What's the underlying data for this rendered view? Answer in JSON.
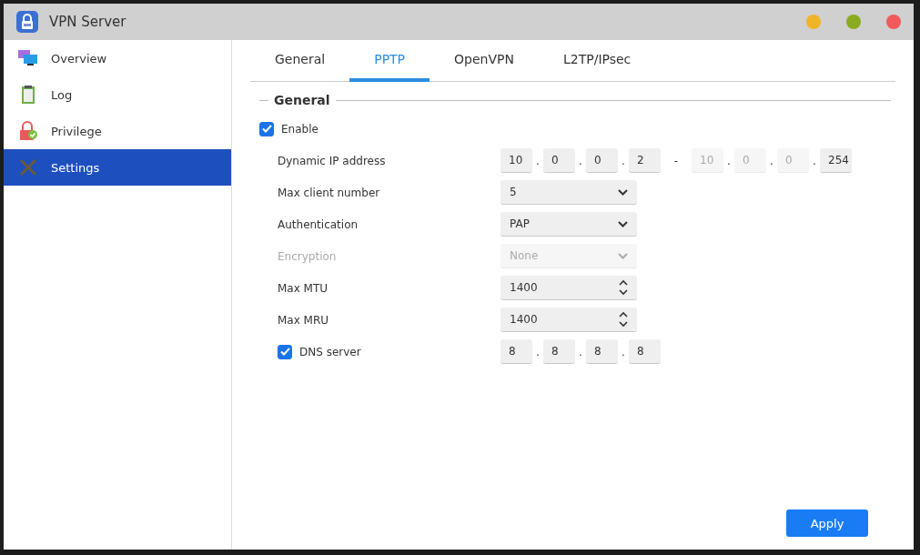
{
  "window": {
    "title": "VPN Server",
    "controls": [
      {
        "color": "#f0b429"
      },
      {
        "color": "#8aab1f"
      },
      {
        "color": "#f05a5a"
      }
    ]
  },
  "sidebar": {
    "items": [
      {
        "label": "Overview",
        "kind": "monitors",
        "selected": false
      },
      {
        "label": "Log",
        "kind": "clipboard",
        "selected": false
      },
      {
        "label": "Privilege",
        "kind": "lock",
        "selected": false
      },
      {
        "label": "Settings",
        "kind": "tools",
        "selected": true
      }
    ]
  },
  "tabs": [
    {
      "label": "General",
      "selected": false
    },
    {
      "label": "PPTP",
      "selected": true
    },
    {
      "label": "OpenVPN",
      "selected": false
    },
    {
      "label": "L2TP/IPsec",
      "selected": false
    }
  ],
  "section": {
    "title": "General"
  },
  "rows": [
    {
      "kind": "checkbox",
      "label": "Enable",
      "checked": true
    },
    {
      "kind": "ip_range",
      "label": "Dynamic IP address",
      "start_dots": [
        ".",
        ".",
        "."
      ],
      "end_dots": [
        ".",
        ".",
        "."
      ],
      "start": [
        {
          "value": "10",
          "disabled": false
        },
        {
          "value": "0",
          "disabled": false
        },
        {
          "value": "0",
          "disabled": false
        },
        {
          "value": "2",
          "disabled": false
        }
      ],
      "separator": "-",
      "end": [
        {
          "value": "10",
          "disabled": true
        },
        {
          "value": "0",
          "disabled": true
        },
        {
          "value": "0",
          "disabled": true
        },
        {
          "value": "254",
          "disabled": false
        }
      ]
    },
    {
      "kind": "select",
      "label": "Max client number",
      "value": "5",
      "disabled": false
    },
    {
      "kind": "select",
      "label": "Authentication",
      "value": "PAP",
      "disabled": false
    },
    {
      "kind": "select",
      "label": "Encryption",
      "value": "None",
      "disabled": true
    },
    {
      "kind": "number",
      "label": "Max MTU",
      "value": "1400",
      "disabled": false
    },
    {
      "kind": "number",
      "label": "Max MRU",
      "value": "1400",
      "disabled": false
    },
    {
      "kind": "ip_check",
      "label": "DNS server",
      "checked": true,
      "dots": [
        ".",
        ".",
        "."
      ],
      "octets": [
        {
          "value": "8",
          "disabled": false
        },
        {
          "value": "8",
          "disabled": false
        },
        {
          "value": "8",
          "disabled": false
        },
        {
          "value": "8",
          "disabled": false
        }
      ]
    }
  ],
  "apply_button": "Apply"
}
